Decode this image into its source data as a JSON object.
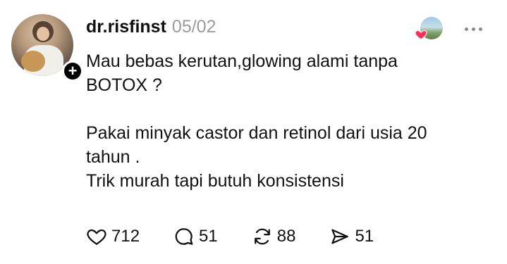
{
  "post": {
    "username": "dr.risfinst",
    "timestamp": "05/02",
    "follow_symbol": "+",
    "text_lines_1": [
      "Mau bebas kerutan,glowing alami tanpa",
      "BOTOX ?"
    ],
    "text_lines_2": [
      "Pakai minyak castor dan retinol dari usia 20",
      "tahun .",
      "Trik murah tapi butuh konsistensi"
    ]
  },
  "actions": {
    "likes": "712",
    "comments": "51",
    "reposts": "88",
    "shares": "51"
  },
  "icons": {
    "like": "heart-outline-icon",
    "comment": "speech-bubble-icon",
    "repost": "repost-arrows-icon",
    "share": "send-arrow-icon",
    "more": "more-dots-icon",
    "liked_badge": "red-heart-icon"
  },
  "colors": {
    "text": "#111111",
    "muted": "#9b9b9b",
    "heart_red": "#ff2d55"
  }
}
